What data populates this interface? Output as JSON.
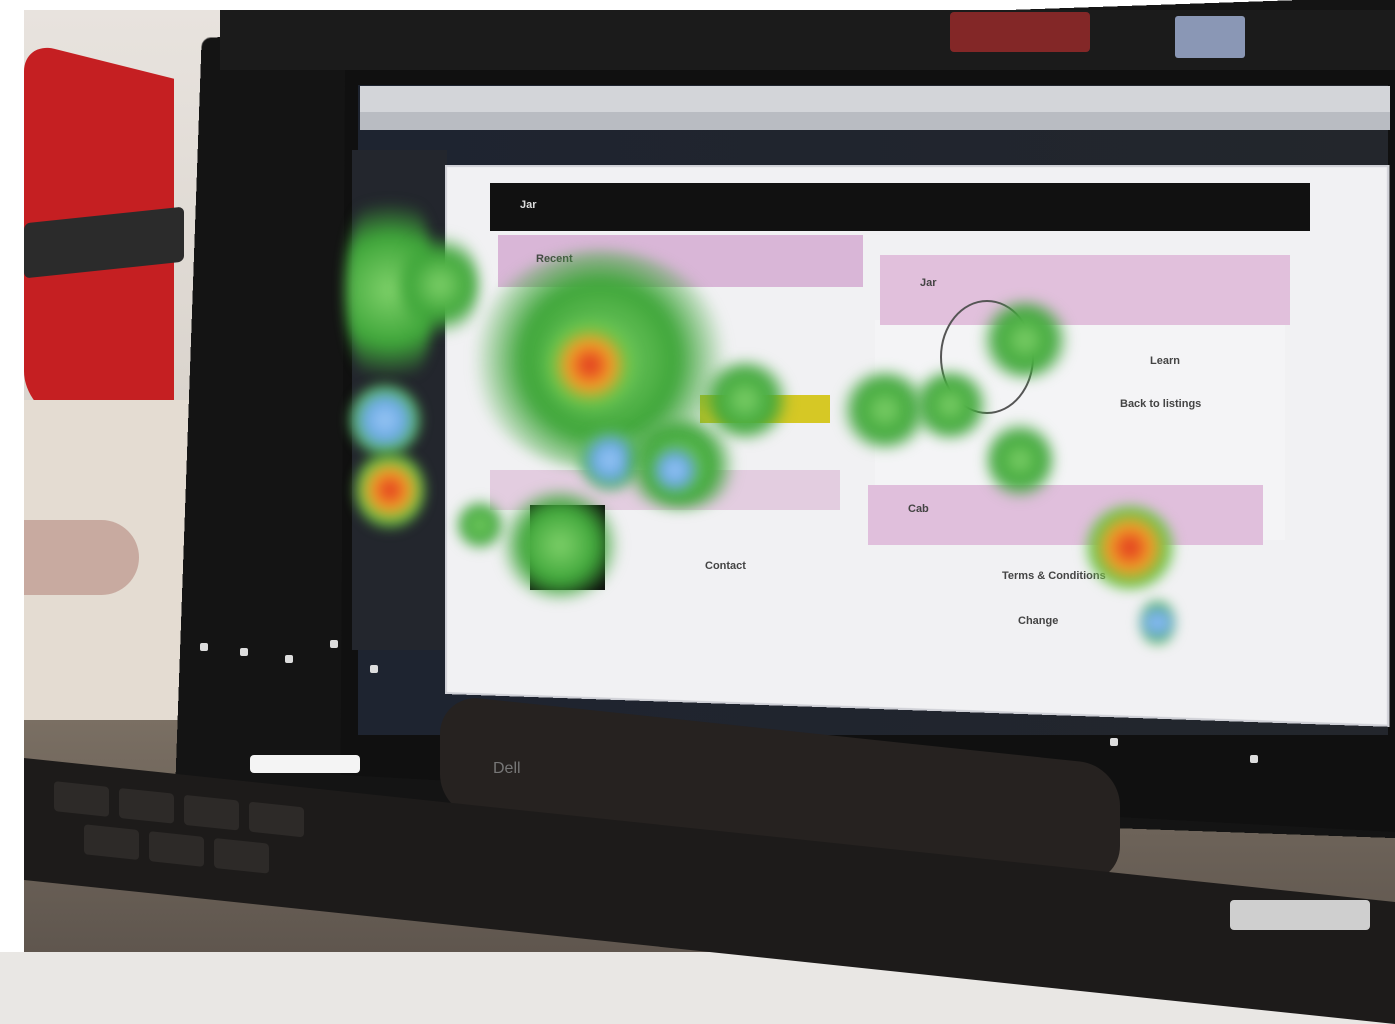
{
  "scene": {
    "description_tags": [
      "laptop",
      "eye-tracking-heatmap",
      "office"
    ]
  },
  "screen": {
    "header_label": "Jar",
    "left_panel_label": "Recent",
    "right_panel_label": "Jar",
    "right_panel2_label": "Cab",
    "link_1": "Learn",
    "link_2": "Back to listings",
    "link_3": "Terms & Conditions",
    "link_4": "Change",
    "left_footer": "Contact",
    "hinge_logo": "Dell"
  },
  "colors": {
    "bezel": "#141414",
    "chair_red": "#c51f22",
    "panel_pink": "#d9b6d7",
    "heat_green": "#3fa63a",
    "heat_red": "#e02b1f"
  }
}
